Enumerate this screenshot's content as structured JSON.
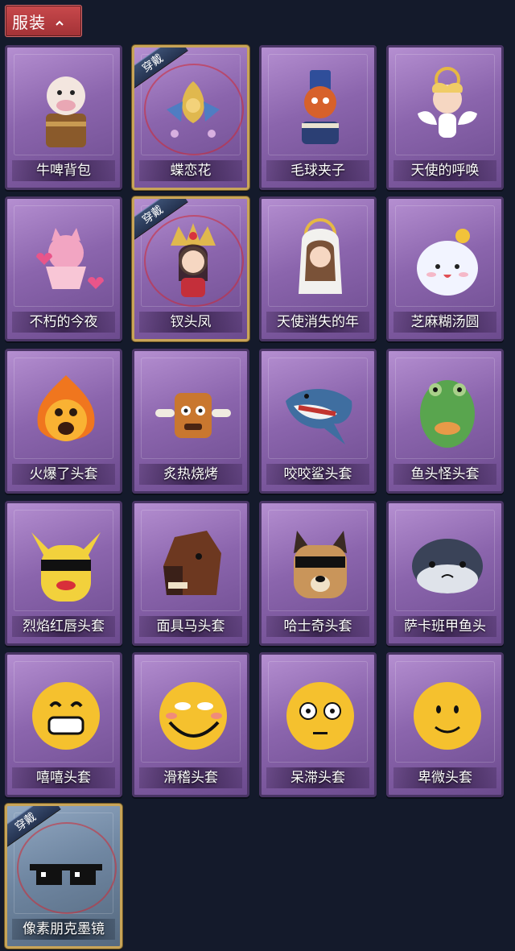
{
  "header": {
    "title": "服装"
  },
  "badge_text": "穿戴",
  "items": [
    {
      "label": "牛啤背包",
      "icon": "cow-beer-backpack-icon",
      "equipped": false
    },
    {
      "label": "蝶恋花",
      "icon": "butterfly-flower-crown-icon",
      "equipped": true
    },
    {
      "label": "毛球夹子",
      "icon": "red-panda-drummer-icon",
      "equipped": false
    },
    {
      "label": "天使的呼唤",
      "icon": "angel-cherub-icon",
      "equipped": false
    },
    {
      "label": "不朽的今夜",
      "icon": "pink-cat-bowl-icon",
      "equipped": false
    },
    {
      "label": "钗头凤",
      "icon": "phoenix-crown-doll-icon",
      "equipped": true
    },
    {
      "label": "天使消失的年",
      "icon": "veiled-girl-halo-icon",
      "equipped": false
    },
    {
      "label": "芝麻糊汤圆",
      "icon": "rice-ball-flower-icon",
      "equipped": false
    },
    {
      "label": "火爆了头套",
      "icon": "flame-head-icon",
      "equipped": false
    },
    {
      "label": "炙热烧烤",
      "icon": "bbq-meat-head-icon",
      "equipped": false
    },
    {
      "label": "咬咬鲨头套",
      "icon": "shark-head-icon",
      "equipped": false
    },
    {
      "label": "鱼头怪头套",
      "icon": "fish-monster-head-icon",
      "equipped": false
    },
    {
      "label": "烈焰红唇头套",
      "icon": "pikachu-lips-head-icon",
      "equipped": false
    },
    {
      "label": "面具马头套",
      "icon": "horse-mask-head-icon",
      "equipped": false
    },
    {
      "label": "哈士奇头套",
      "icon": "husky-sunglasses-head-icon",
      "equipped": false
    },
    {
      "label": "萨卡班甲鱼头",
      "icon": "sacabambaspis-head-icon",
      "equipped": false
    },
    {
      "label": "嘻嘻头套",
      "icon": "grin-emoji-head-icon",
      "equipped": false
    },
    {
      "label": "滑稽头套",
      "icon": "funny-smile-emoji-head-icon",
      "equipped": false
    },
    {
      "label": "呆滞头套",
      "icon": "blank-stare-emoji-head-icon",
      "equipped": false
    },
    {
      "label": "卑微头套",
      "icon": "shy-emoji-head-icon",
      "equipped": false
    },
    {
      "label": "像素朋克墨镜",
      "icon": "pixel-sunglasses-icon",
      "equipped": true,
      "variant": "blue"
    }
  ]
}
